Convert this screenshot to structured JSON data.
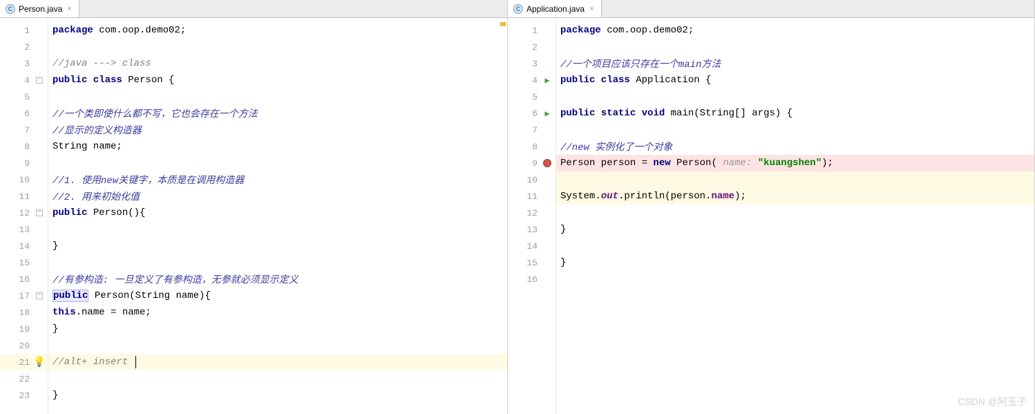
{
  "watermark": "CSDN @阿玉子",
  "left": {
    "tab": "Person.java",
    "lines": {
      "l1": {
        "kw1": "package ",
        "pkg": "com.oop.demo02;"
      },
      "l3": {
        "c": "//java ---> class"
      },
      "l4": {
        "kw1": "public class ",
        "cls": "Person {"
      },
      "l6": {
        "c": "//一个类即使什么都不写，它也会存在一个方法"
      },
      "l7": {
        "c": "//显示的定义构造器"
      },
      "l8": {
        "t": "String name;"
      },
      "l10": {
        "c": "//1. 使用new关键字，本质是在调用构造器"
      },
      "l11": {
        "c": "//2. 用来初始化值"
      },
      "l12": {
        "kw": "public",
        "rest": " Person(){"
      },
      "l14": {
        "t": "}"
      },
      "l16": {
        "c": "//有参构造: 一旦定义了有参构造，无参就必须显示定义"
      },
      "l17": {
        "kw": "public",
        "rest": " Person(String name){"
      },
      "l18": {
        "kw": "this",
        "rest1": ".name = name;"
      },
      "l19": {
        "t": "}"
      },
      "l21": {
        "c": "//alt+ insert "
      },
      "l23": {
        "t": "}"
      }
    }
  },
  "right": {
    "tab": "Application.java",
    "lines": {
      "l1": {
        "kw1": "package ",
        "pkg": "com.oop.demo02;"
      },
      "l3": {
        "c": "//一个项目应该只存在一个main方法"
      },
      "l4": {
        "kw1": "public class ",
        "cls": "Application {"
      },
      "l6": {
        "kw": "public static void ",
        "m": "main(String[] args) {"
      },
      "l8": {
        "c": "//new 实例化了一个对象"
      },
      "l9": {
        "t1": "Person person = ",
        "kw": "new",
        "t2": " Person( ",
        "hint": "name: ",
        "str": "\"kuangshen\"",
        "t3": ");"
      },
      "l11": {
        "t1": "System.",
        "f1": "out",
        "t2": ".println(person.",
        "f2": "name",
        "t3": ");"
      },
      "l13": {
        "t": "}"
      },
      "l15": {
        "t": "}"
      }
    }
  }
}
